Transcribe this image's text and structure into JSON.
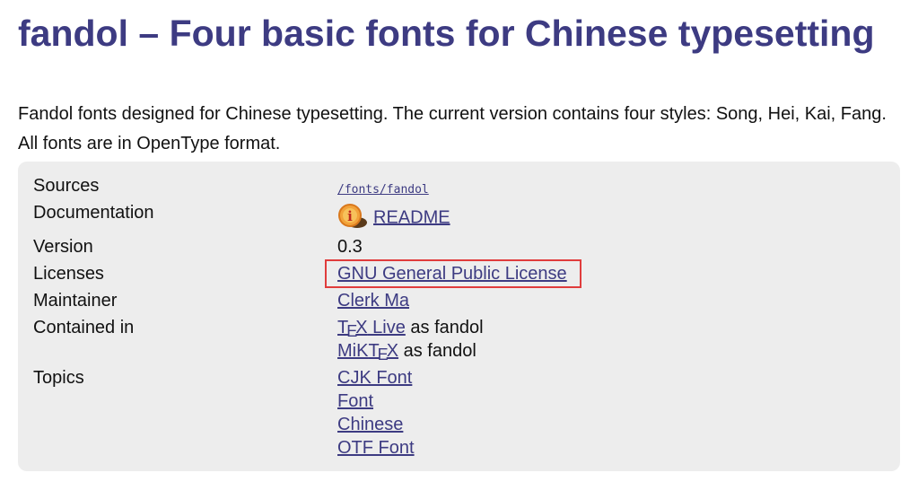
{
  "title": "fandol – Four basic fonts for Chinese typesetting",
  "description": {
    "line1": "Fandol fonts designed for Chinese typesetting. The current version contains four styles: Song, Hei, Kai, Fang.",
    "line2": "All fonts are in OpenType format."
  },
  "info": {
    "sources": {
      "label": "Sources",
      "value": "/fonts/fandol"
    },
    "documentation": {
      "label": "Documentation",
      "value": "README",
      "icon": "info-icon"
    },
    "version": {
      "label": "Version",
      "value": "0.3"
    },
    "licenses": {
      "label": "Licenses",
      "value": "GNU General Public License"
    },
    "maintainer": {
      "label": "Maintainer",
      "value": "Clerk Ma"
    },
    "contained_in": {
      "label": "Contained in",
      "items": [
        {
          "tex_t": "T",
          "tex_e": "E",
          "tex_x": "X",
          "rest": " Live",
          "suffix": "as fandol"
        },
        {
          "prefix": "MiK",
          "tex_t": "T",
          "tex_e": "E",
          "tex_x": "X",
          "suffix": "as fandol"
        }
      ]
    },
    "topics": {
      "label": "Topics",
      "items": [
        "CJK Font",
        "Font",
        "Chinese",
        "OTF Font"
      ]
    }
  },
  "colors": {
    "heading": "#3d3b82",
    "link": "#3d3b82",
    "box_background": "#ededed",
    "highlight": "#e03c3c"
  }
}
